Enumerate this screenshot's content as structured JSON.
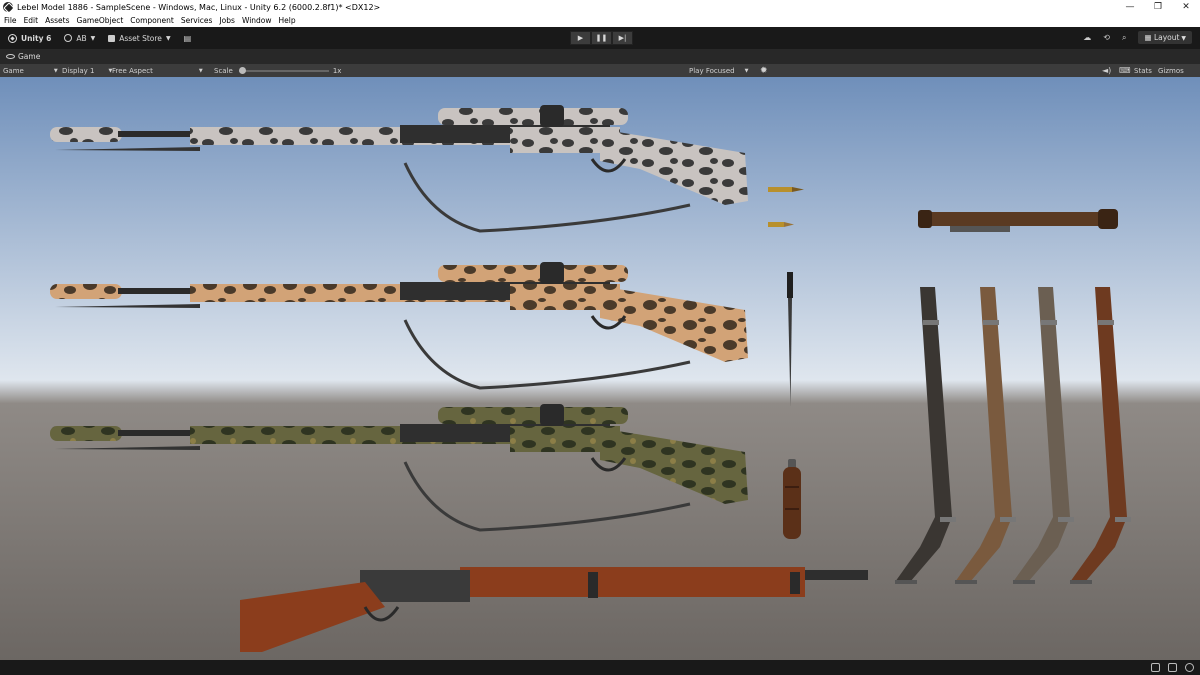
{
  "window": {
    "title": "Lebel Model 1886 - SampleScene - Windows, Mac, Linux - Unity 6.2 (6000.2.8f1)* <DX12>",
    "controls": [
      "—",
      "❐",
      "✕"
    ]
  },
  "menu": [
    "File",
    "Edit",
    "Assets",
    "GameObject",
    "Component",
    "Services",
    "Jobs",
    "Window",
    "Help"
  ],
  "toolbar": {
    "unity_label": "Unity 6",
    "account_label": "AB",
    "asset_store_label": "Asset Store",
    "layout_label": "Layout",
    "play_icon": "▶",
    "pause_icon": "❚❚",
    "step_icon": "▶|"
  },
  "tab": {
    "label": "Game"
  },
  "gamebar": {
    "view_label": "Game",
    "display_label": "Display 1",
    "aspect_label": "Free Aspect",
    "scale_label": "Scale",
    "scale_value": "1x",
    "play_mode_label": "Play Focused",
    "stats_label": "Stats",
    "gizmos_label": "Gizmos"
  },
  "colors": {
    "sky_top": "#6f8fba",
    "sky_horizon": "#dfe6ee",
    "ground": "#6c6763",
    "ground_far": "#8f8a86"
  },
  "scene": {
    "rifles": [
      {
        "name": "arctic-camo-rifle",
        "body": "#c8c3c0",
        "spot": "#3a3a3a"
      },
      {
        "name": "desert-camo-rifle",
        "body": "#d2a377",
        "spot": "#4a3a2a"
      },
      {
        "name": "woodland-camo-rifle",
        "body": "#66653f",
        "spot": "#2f3421"
      },
      {
        "name": "wooden-rifle",
        "body": "#8b3d1c",
        "spot": "#5a2812"
      }
    ],
    "slings": [
      "#3a3632",
      "#7a5a3e",
      "#6b5f52",
      "#6e3a20"
    ]
  }
}
